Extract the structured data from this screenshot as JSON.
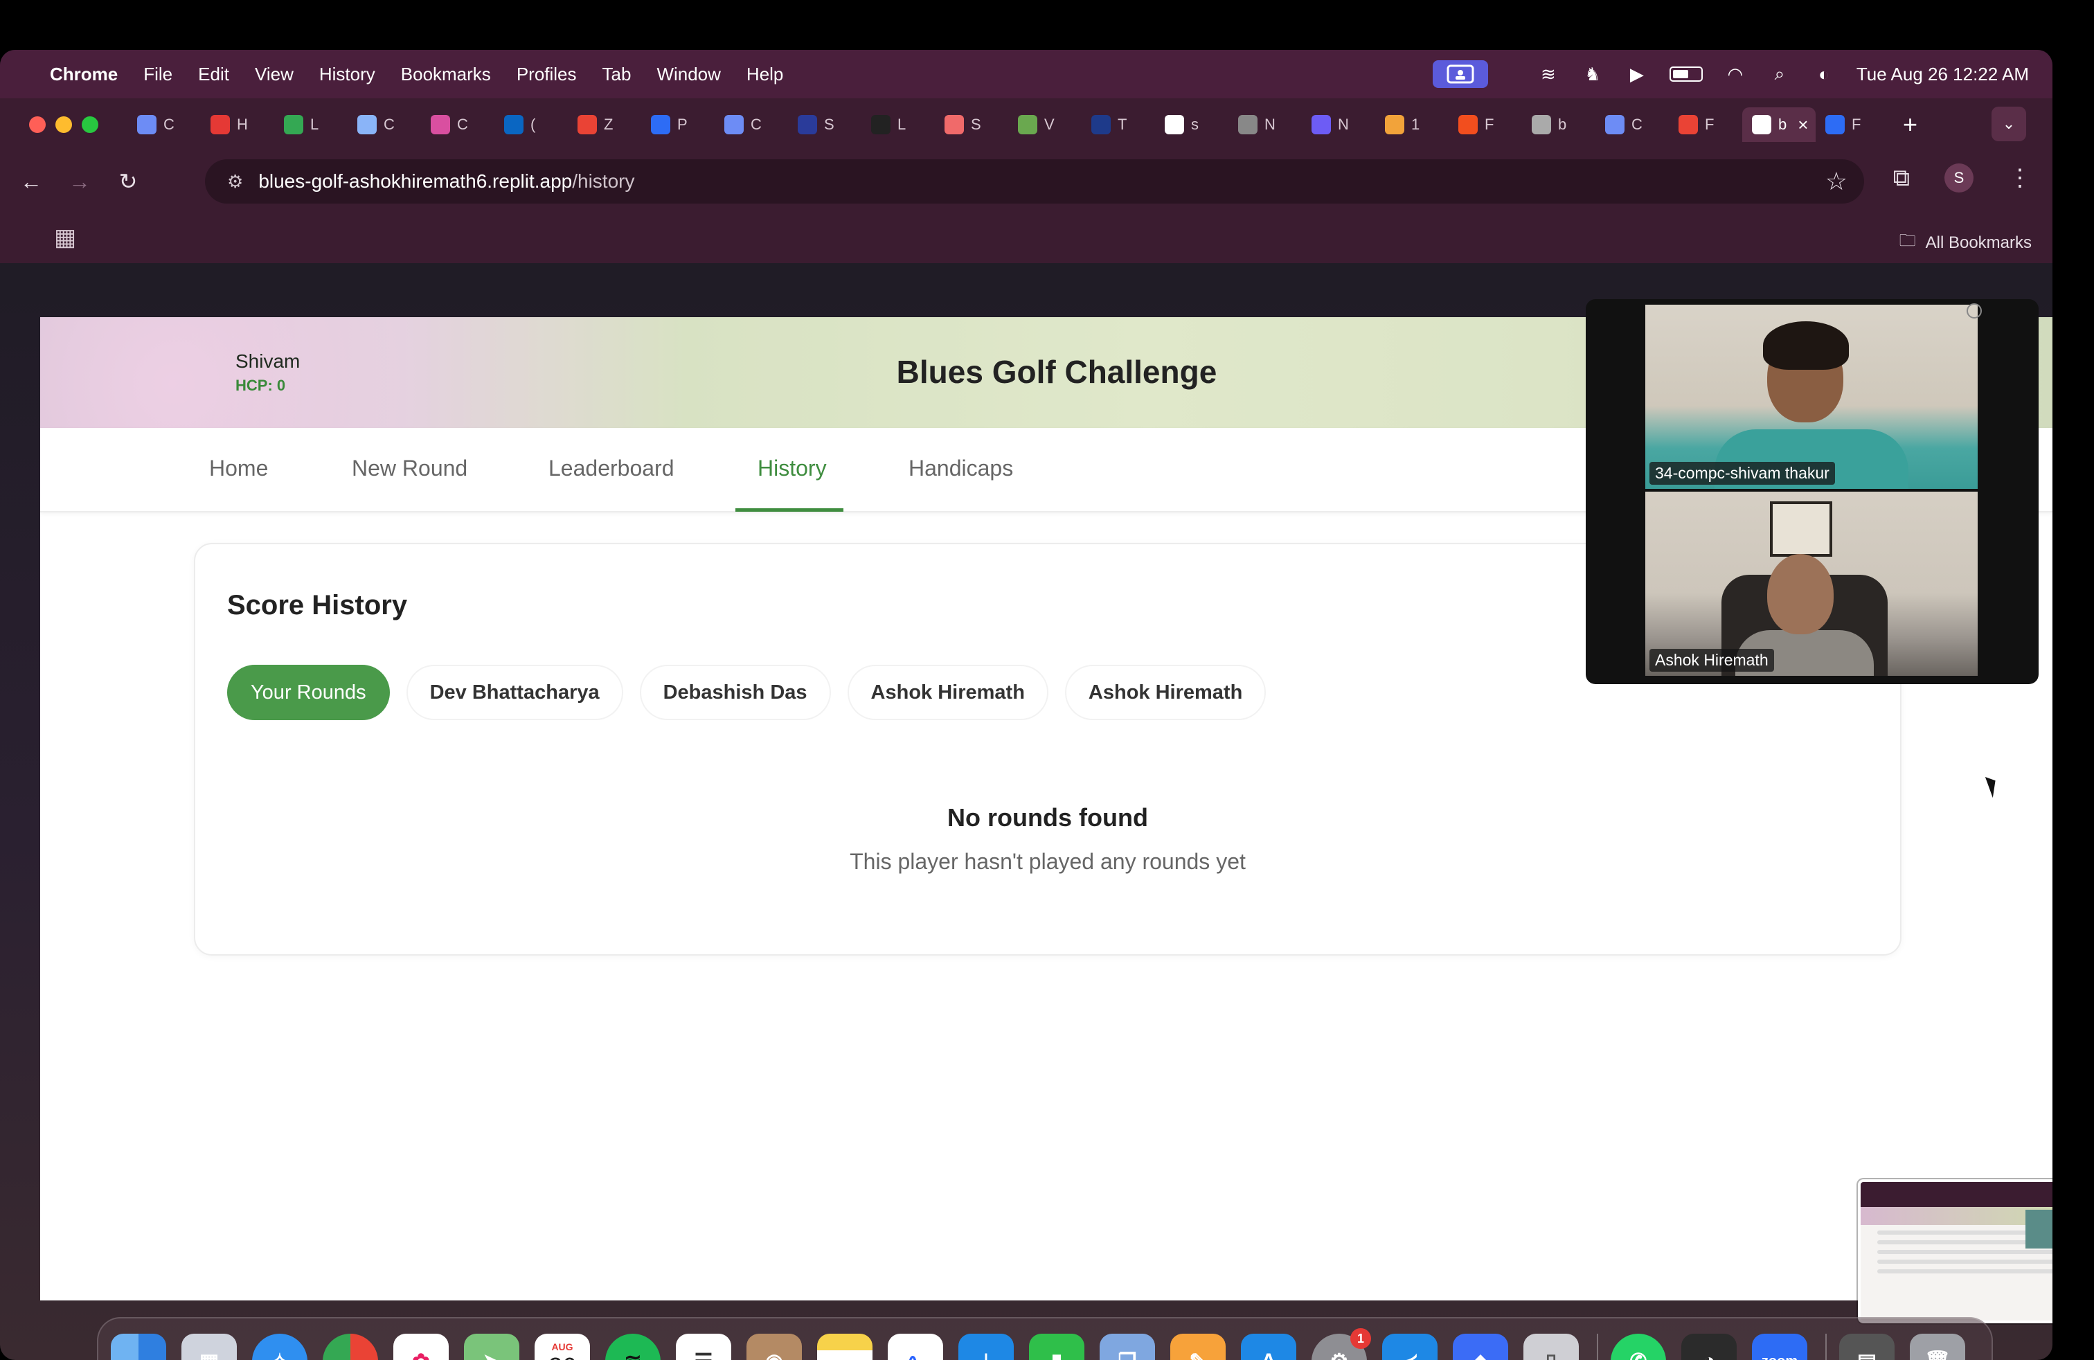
{
  "menubar": {
    "app": "Chrome",
    "items": [
      "File",
      "Edit",
      "View",
      "History",
      "Bookmarks",
      "Profiles",
      "Tab",
      "Window",
      "Help"
    ],
    "datetime": "Tue Aug 26  12:22 AM"
  },
  "browser": {
    "tabs": [
      {
        "icon": "gemini-icon",
        "label": "C",
        "color": "#6d8cf5"
      },
      {
        "icon": "youtube-icon",
        "label": "H",
        "color": "#e53935"
      },
      {
        "icon": "sheets-icon",
        "label": "L",
        "color": "#34a853"
      },
      {
        "icon": "docs-icon",
        "label": "C",
        "color": "#8ab4f8"
      },
      {
        "icon": "app-icon",
        "label": "C",
        "color": "#d94fa0"
      },
      {
        "icon": "linkedin-icon",
        "label": "(",
        "color": "#0a66c2"
      },
      {
        "icon": "gmail-icon",
        "label": "Z",
        "color": "#ea4335"
      },
      {
        "icon": "zoom-icon",
        "label": "P",
        "color": "#2d6cf5"
      },
      {
        "icon": "gemini-icon",
        "label": "C",
        "color": "#6d8cf5"
      },
      {
        "icon": "app-icon",
        "label": "S",
        "color": "#2a3b9a"
      },
      {
        "icon": "app-icon",
        "label": "L",
        "color": "#222222"
      },
      {
        "icon": "asana-icon",
        "label": "S",
        "color": "#f06a6a"
      },
      {
        "icon": "app-icon",
        "label": "V",
        "color": "#6aa84f"
      },
      {
        "icon": "app-icon",
        "label": "T",
        "color": "#1e3a8a"
      },
      {
        "icon": "google-icon",
        "label": "s",
        "color": "#ffffff"
      },
      {
        "icon": "app-icon",
        "label": "N",
        "color": "#888888"
      },
      {
        "icon": "settings-icon",
        "label": "N",
        "color": "#6d5cf5"
      },
      {
        "icon": "app-icon",
        "label": "1",
        "color": "#f2a33a"
      },
      {
        "icon": "figma-icon",
        "label": "F",
        "color": "#f24e1e"
      },
      {
        "icon": "globe-icon",
        "label": "b",
        "color": "#aaaaaa"
      },
      {
        "icon": "gemini-icon",
        "label": "C",
        "color": "#6d8cf5"
      },
      {
        "icon": "gmail-icon",
        "label": "F",
        "color": "#ea4335"
      },
      {
        "icon": "app-icon",
        "label": "b",
        "color": "#ffffff",
        "active": true
      },
      {
        "icon": "zoom-icon",
        "label": "F",
        "color": "#2d6cf5"
      }
    ],
    "url_host": "blues-golf-ashokhiremath6.replit.app",
    "url_path": "/history",
    "profile_initial": "S",
    "all_bookmarks": "All Bookmarks"
  },
  "app": {
    "title": "Blues Golf Challenge",
    "user_name": "Shivam",
    "user_hcp": "HCP: 0",
    "nav": [
      {
        "label": "Home",
        "active": false
      },
      {
        "label": "New Round",
        "active": false
      },
      {
        "label": "Leaderboard",
        "active": false
      },
      {
        "label": "History",
        "active": true
      },
      {
        "label": "Handicaps",
        "active": false
      }
    ],
    "card_title": "Score History",
    "players": [
      {
        "label": "Your Rounds",
        "active": true
      },
      {
        "label": "Dev Bhattacharya",
        "active": false
      },
      {
        "label": "Debashish Das",
        "active": false
      },
      {
        "label": "Ashok Hiremath",
        "active": false
      },
      {
        "label": "Ashok Hiremath",
        "active": false
      }
    ],
    "empty_title": "No rounds found",
    "empty_subtitle": "This player hasn't played any rounds yet",
    "accent_color": "#4a9a4a"
  },
  "video_call": {
    "participants": [
      "34-compc-shivam thakur",
      "Ashok Hiremath"
    ]
  },
  "dock": {
    "calendar_month": "AUG",
    "calendar_day": "26",
    "settings_badge": "1",
    "zoom_label": "zoom"
  }
}
